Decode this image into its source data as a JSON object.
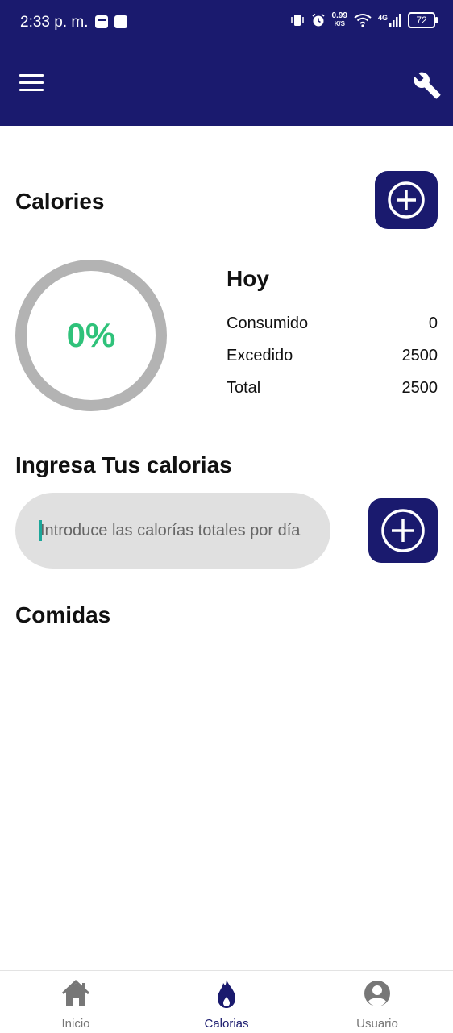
{
  "status_bar": {
    "time": "2:33 p. m.",
    "net_speed_top": "0.99",
    "net_speed_bottom": "K/S",
    "network_type": "4G",
    "battery": "72"
  },
  "header": {
    "menu_icon": "hamburger-menu-icon",
    "settings_icon": "wrench-icon"
  },
  "calories": {
    "title": "Calories",
    "add_icon": "plus-circle-icon",
    "progress_percent": "0%",
    "progress_value": 0,
    "today": {
      "title": "Hoy",
      "rows": [
        {
          "label": "Consumido",
          "value": "0"
        },
        {
          "label": "Excedido",
          "value": "2500"
        },
        {
          "label": "Total",
          "value": "2500"
        }
      ]
    }
  },
  "input_section": {
    "title": "Ingresa Tus calorias",
    "placeholder": "Introduce las calorías totales por día",
    "add_icon": "plus-circle-icon"
  },
  "meals": {
    "title": "Comidas"
  },
  "bottom_nav": {
    "items": [
      {
        "label": "Inicio",
        "icon": "home-icon",
        "active": false
      },
      {
        "label": "Calorias",
        "icon": "flame-icon",
        "active": true
      },
      {
        "label": "Usuario",
        "icon": "user-circle-icon",
        "active": false
      }
    ]
  },
  "colors": {
    "primary": "#1a1a6e",
    "progress_text": "#2fc27a",
    "ring": "#b3b3b3",
    "input_bg": "#e0e0e0",
    "nav_inactive": "#777777"
  }
}
